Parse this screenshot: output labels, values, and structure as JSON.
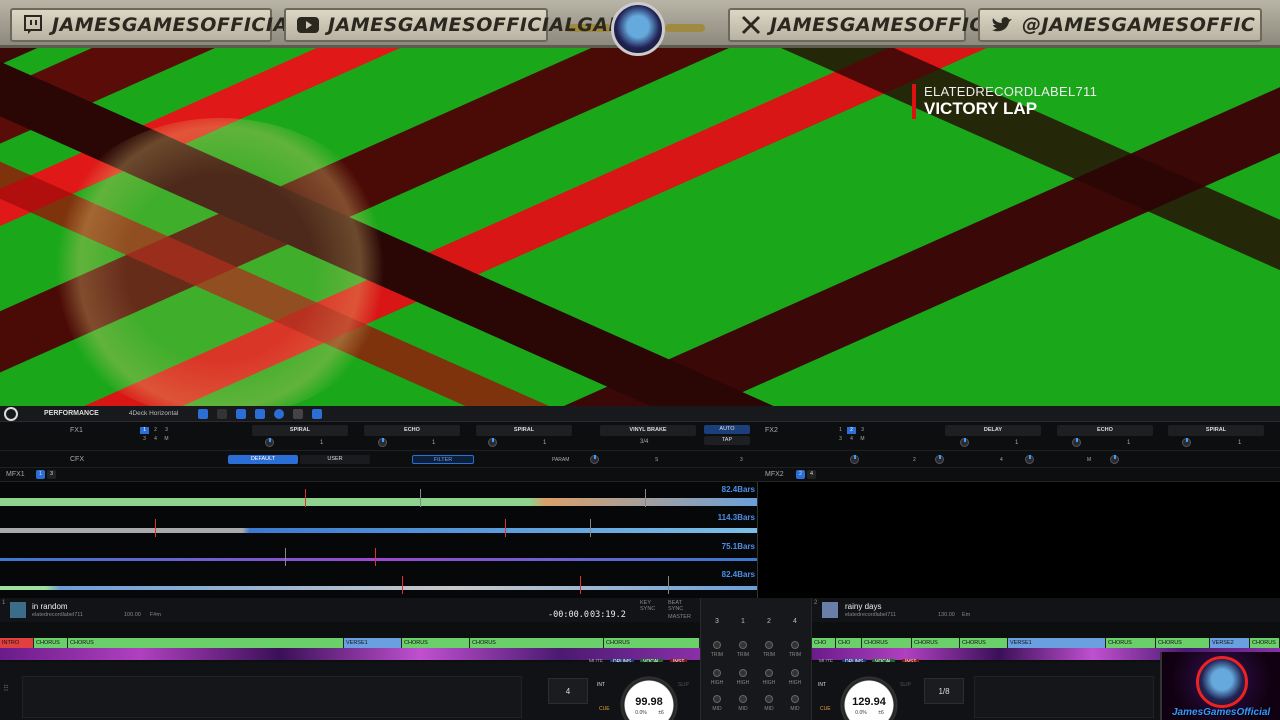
{
  "banner": {
    "twitch_handle": "JAMESGAMESOFFICIAL",
    "youtube_handle": "JAMESGAMESOFFICIALGAME",
    "x_handle": "JAMESGAMESOFFICIAL",
    "twitter_handle": "@JAMESGAMESOFFIC"
  },
  "now_playing": {
    "artist": "ELATEDRECORDLABEL711",
    "title": "VICTORY LAP"
  },
  "topbar": {
    "mode": "PERFORMANCE",
    "layout": "4Deck Horizontal"
  },
  "fx1": {
    "label": "FX1",
    "beats": [
      "1",
      "2",
      "3",
      "3",
      "4",
      "M"
    ],
    "slots": [
      "SPIRAL",
      "ECHO",
      "SPIRAL"
    ],
    "slot_values": [
      "1",
      "1",
      "1"
    ],
    "vinyl_brake": "VINYL BRAKE",
    "ratio": "3/4",
    "auto": "AUTO",
    "tap": "TAP"
  },
  "fx2": {
    "label": "FX2",
    "beats": [
      "1",
      "2",
      "3",
      "3",
      "4",
      "M"
    ],
    "slots": [
      "DELAY",
      "ECHO",
      "SPIRAL"
    ],
    "slot_values": [
      "1",
      "1",
      "1"
    ],
    "knob_labels": [
      "2",
      "4",
      "M"
    ]
  },
  "cfx": {
    "label": "CFX",
    "default": "DEFAULT",
    "user": "USER",
    "filter": "FILTER",
    "param": "PARAM",
    "param_values": [
      "S",
      "3"
    ]
  },
  "mfx": {
    "left": "MFX1",
    "right": "MFX2",
    "left_pages": [
      "1",
      "3"
    ],
    "right_pages": [
      "2",
      "4"
    ]
  },
  "waveforms": [
    "82.4Bars",
    "114.3Bars",
    "75.1Bars",
    "82.4Bars"
  ],
  "deck1": {
    "number": "1",
    "title": "in random",
    "artist": "elatedrecordlabel711",
    "bpm_info": "100.00",
    "key": "F#m",
    "elapsed": "-00:00.0",
    "remaining": "03:19.2",
    "sync_labels": [
      "KEY",
      "SYNC",
      "BEAT",
      "SYNC",
      "MASTER"
    ],
    "phrases": [
      "INTRO",
      "CHORUS",
      "CHORUS",
      "VERSE1",
      "CHORUS",
      "CHORUS",
      "CHORUS"
    ],
    "tags": [
      "MUTE",
      "DRUMS",
      "VOCAL",
      "INST"
    ],
    "bpm": "99.98",
    "pitch": "0.0%",
    "pitch_range": "±6",
    "beatjump": "4",
    "int_label": "INT",
    "slip_label": "SLIP",
    "cue_label": "CUE"
  },
  "deck2": {
    "number": "2",
    "title": "rainy days",
    "artist": "elatedrecordlabel711",
    "bpm_info": "130.00",
    "key": "Em",
    "phrases": [
      "CHO",
      "CHO",
      "CHORUS",
      "CHORUS",
      "CHORUS",
      "VERSE1",
      "CHORUS",
      "CHORUS",
      "VERSE2",
      "CHORUS"
    ],
    "tags": [
      "MUTE",
      "DRUMS",
      "VOCAL",
      "INST"
    ],
    "bpm": "129.94",
    "pitch": "0.0%",
    "pitch_range": "±6",
    "beatjump": "1/8",
    "int_label": "INT",
    "slip_label": "SLIP",
    "cue_label": "CUE"
  },
  "mixer": {
    "channels": [
      "3",
      "1",
      "2",
      "4"
    ],
    "rows": [
      "TRIM",
      "HIGH",
      "MID"
    ]
  },
  "webcam": {
    "caption": "JamesGamesOfficial"
  },
  "colors": {
    "accent": "#2b6fd6",
    "video_green": "#1aa81a",
    "video_red": "#e01818",
    "live_red": "#d11111"
  }
}
